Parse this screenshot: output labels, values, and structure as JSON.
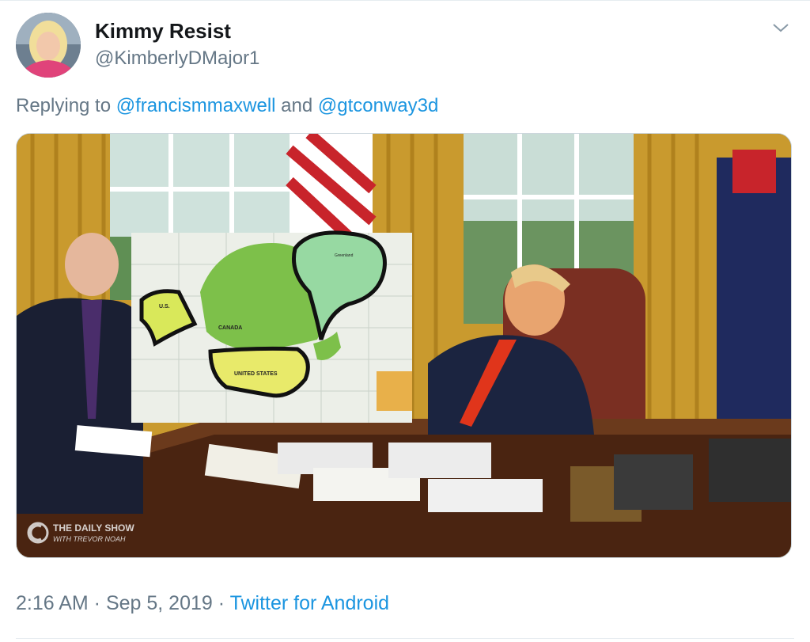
{
  "tweet": {
    "author_name": "Kimmy Resist",
    "author_handle": "@KimberlyDMajor1",
    "replying_prefix": "Replying to ",
    "reply_user_1": "@francismmaxwell",
    "reply_and": " and ",
    "reply_user_2": "@gtconway3d",
    "time": "2:16 AM",
    "separator": " · ",
    "date": "Sep 5, 2019",
    "source": "Twitter for Android"
  },
  "media": {
    "map_labels": {
      "us": "U.S.",
      "canada": "CANADA",
      "united_states": "UNITED STATES",
      "greenland": "Greenland"
    },
    "watermark_line1": "THE DAILY SHOW",
    "watermark_line2": "WITH TREVOR NOAH"
  },
  "icons": {
    "menu": "chevron-down-icon",
    "watermark": "comedy-central-logo-icon"
  },
  "colors": {
    "link": "#1b95e0",
    "secondary_text": "#657786",
    "primary_text": "#14171a"
  }
}
